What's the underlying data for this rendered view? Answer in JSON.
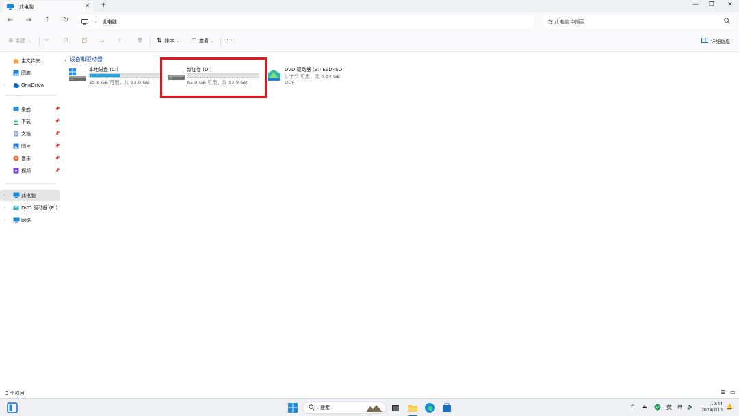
{
  "window": {
    "tab_title": "此电脑",
    "tab_close": "✕",
    "new_tab": "+",
    "minimize": "—",
    "restore": "❐",
    "close": "✕"
  },
  "address": {
    "crumb": "此电脑",
    "search_placeholder": "在 此电脑 中搜索"
  },
  "commands": {
    "new": "新建",
    "sort": "排序",
    "view": "查看",
    "more": "···",
    "details": "详细信息"
  },
  "sidebar": {
    "items": [
      {
        "label": "主文件夹",
        "icon": "home-icon"
      },
      {
        "label": "图库",
        "icon": "gallery-icon"
      },
      {
        "label": "OneDrive",
        "icon": "cloud-icon"
      },
      {
        "label": "桌面",
        "icon": "desktop-icon"
      },
      {
        "label": "下载",
        "icon": "download-icon"
      },
      {
        "label": "文档",
        "icon": "documents-icon"
      },
      {
        "label": "图片",
        "icon": "pictures-icon"
      },
      {
        "label": "音乐",
        "icon": "music-icon"
      },
      {
        "label": "视频",
        "icon": "videos-icon"
      },
      {
        "label": "此电脑",
        "icon": "pc-icon"
      },
      {
        "label": "DVD 驱动器 (E:) ESD-ISO",
        "icon": "dvd-icon"
      },
      {
        "label": "网络",
        "icon": "network-icon"
      }
    ]
  },
  "main": {
    "section_title": "设备和驱动器",
    "drives": [
      {
        "name": "本地磁盘 (C:)",
        "info": "35.6 GB 可用，共 63.0 GB",
        "used_fraction": 0.435
      },
      {
        "name": "新加卷 (D:)",
        "info": "63.9 GB 可用，共 63.9 GB",
        "used_fraction": 0.0
      },
      {
        "name": "DVD 驱动器 (E:) ESD-ISO",
        "info": "0 字节 可用，共 4.64 GB",
        "fs": "UDF"
      }
    ]
  },
  "status": {
    "count": "3 个项目"
  },
  "taskbar": {
    "search_label": "搜索",
    "ime": "英",
    "time": "10:44",
    "date": "2024/7/13"
  },
  "colors": {
    "accent": "#26a0da",
    "highlight": "#e0181b",
    "section_title": "#1f4fa0"
  }
}
